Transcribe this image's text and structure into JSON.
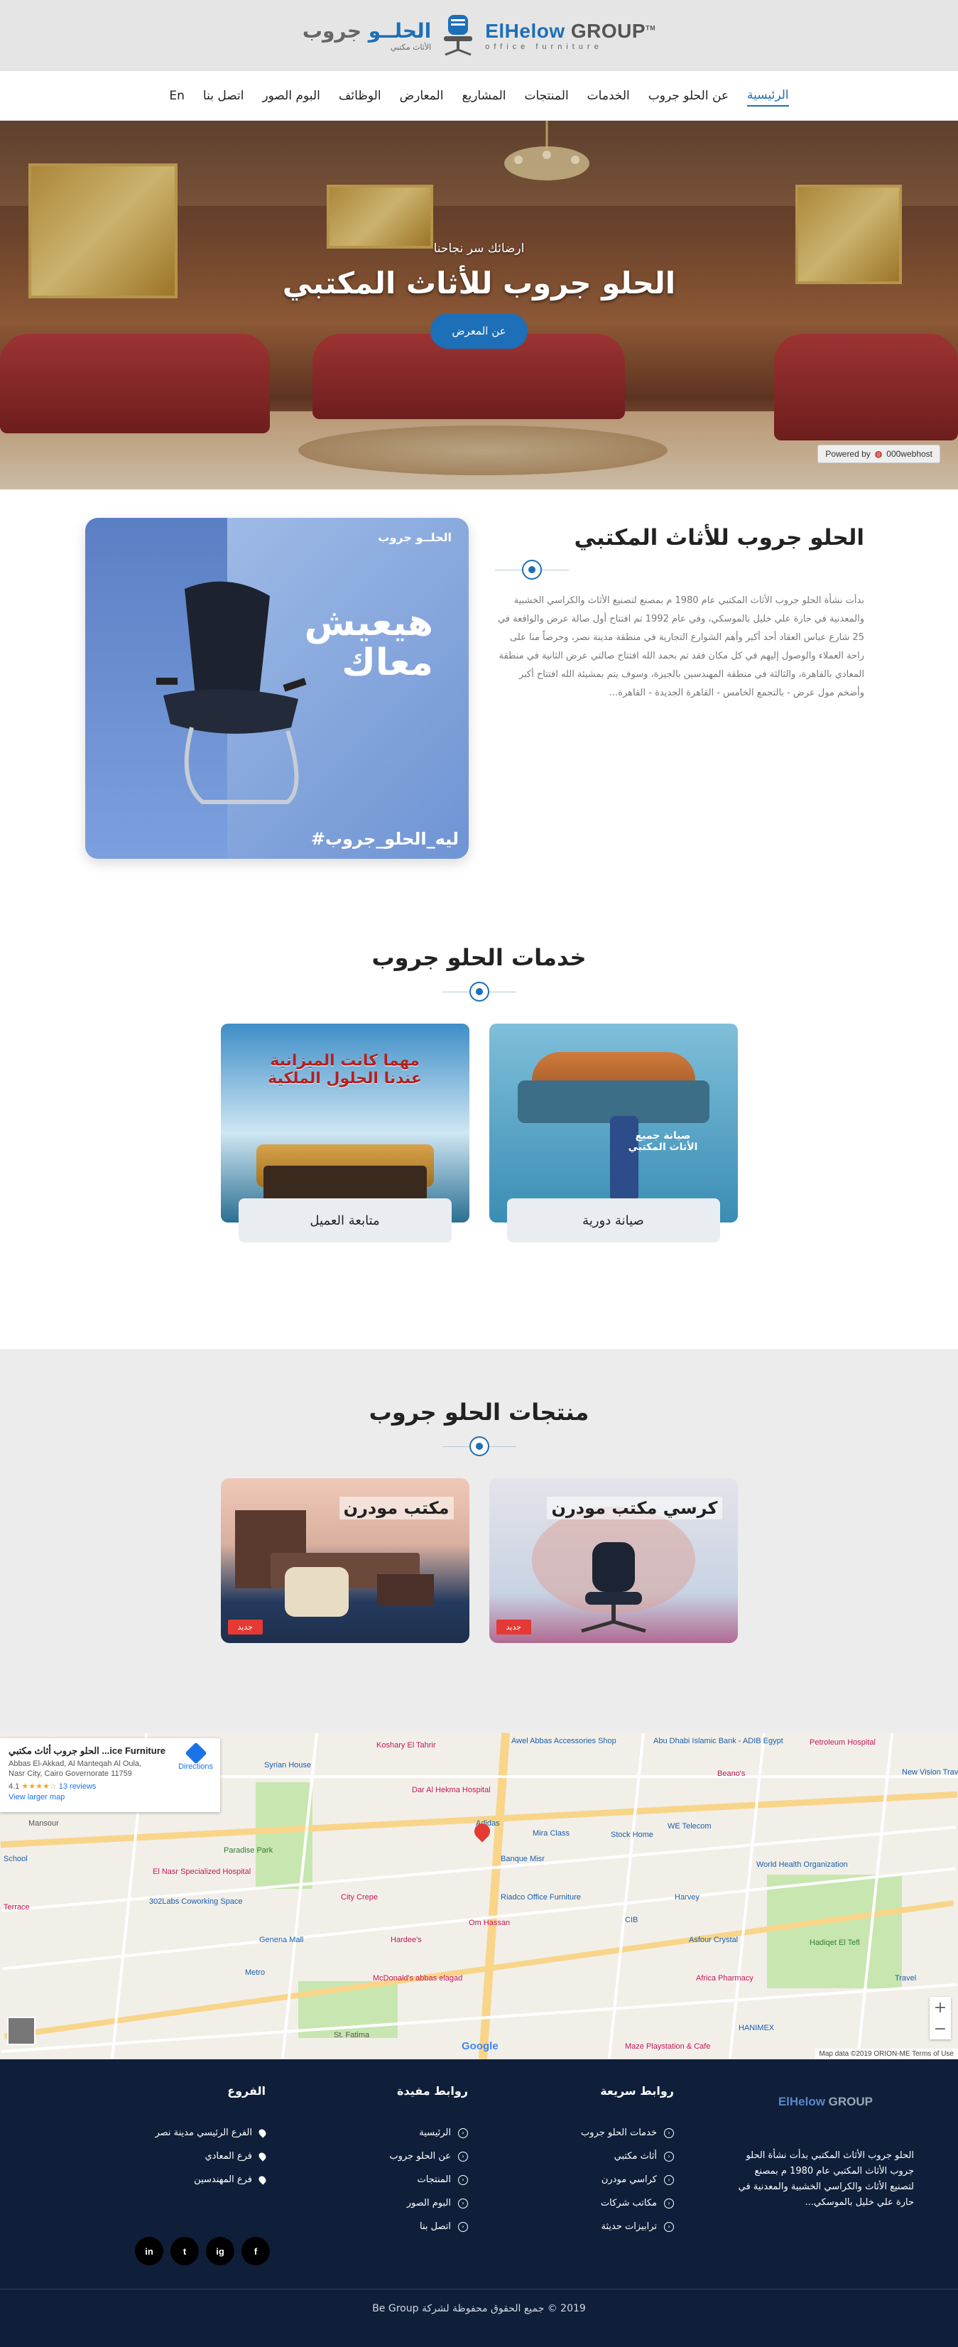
{
  "header": {
    "logo_en_main": "ElHelow",
    "logo_en_group": " GROUP",
    "logo_en_tag": "office furniture",
    "logo_ar_brand": "الحلــو",
    "logo_ar_group": " جروب",
    "logo_ar_tag": "الأثاث مكتبي",
    "tm": "TM"
  },
  "nav": {
    "items": [
      "الرئيسية",
      "عن الحلو جروب",
      "الخدمات",
      "المنتجات",
      "المشاريع",
      "المعارض",
      "الوظائف",
      "البوم الصور",
      "اتصل بنا",
      "En"
    ]
  },
  "hero": {
    "subtitle": "ارضائك سر نجاحنا",
    "title": "الحلو جروب للأثاث المكتبي",
    "button": "عن المعرض",
    "powered_label": "Powered by",
    "powered_brand": "000webhost"
  },
  "about": {
    "title": "الحلو جروب للأثاث المكتبي",
    "body": "بدأت نشأة الحلو جروب الأثاث المكتبي عام 1980 م بمصنع لتصنيع الأثاث والكراسي الخشبية والمعدنية في حارة علي خليل بالموسكي، وفي عام 1992 تم افتتاح أول صالة عرض والواقعة في 25 شارع عباس العقاد أحد أكبر وأهم الشوارع التجارية في منطقة مدينة نصر، وحرصاً منا على راحة العملاء والوصول إليهم في كل مكان فقد تم بحمد الله افتتاح صالتي عرض الثانية في منطقة المعادي بالقاهرة، والثالثة في منطقة المهندسين بالجيزة، وسوف يتم بمشيئة الله افتتاح أكبر وأضخم مول عرض - بالتجمع الخامس - القاهرة الجديدة - القاهرة...",
    "image_slogan_line1": "هيعيش",
    "image_slogan_line2": "معاك",
    "image_hashtag": "#ليه_الحلو_جروب",
    "image_logo": "الحلــو جروب"
  },
  "services": {
    "title": "خدمات الحلو جروب",
    "cards": [
      {
        "caption": "صيانة دورية",
        "image_text": "صيانة جميع الأثاث المكتبي"
      },
      {
        "caption": "متابعة العميل",
        "image_text": "مهما كانت الميزانية عندنا الحلول الملكية"
      }
    ]
  },
  "products": {
    "title": "منتجات الحلو جروب",
    "cards": [
      {
        "title": "كرسي مكتب مودرن",
        "badge": "جديد"
      },
      {
        "title": "مكتب مودرن",
        "badge": "جديد"
      }
    ]
  },
  "map": {
    "card_title": "الحلو جروب أثاث مكتبي ...ice Furniture",
    "card_address": "Abbas El-Akkad, Al Manteqah Al Oula, Nasr City, Cairo Governorate 11759",
    "rating": "4.1",
    "stars": "★★★★☆",
    "reviews": "13 reviews",
    "larger_map": "View larger map",
    "directions": "Directions",
    "labels": [
      "Koshary El Tahrir",
      "Awel Abbas Accessories Shop",
      "Abu Dhabi Islamic Bank - ADIB Egypt",
      "Syrian House",
      "Dar Al Hekma Hospital",
      "Adidas",
      "Mira Class",
      "Stock Home",
      "WE Telecom",
      "Banque Misr",
      "Riadco Office Furniture",
      "City Crepe",
      "Hardee's",
      "Om Hassan",
      "McDonald's abbas elagad",
      "El Nasr Specialized Hospital",
      "302Labs Coworking Space",
      "Genena Mall",
      "Paradise Park",
      "Petroleum Hospital",
      "World Health Organization",
      "Harvey",
      "Asfour Crystal",
      "Africa Pharmacy",
      "HANIMEX",
      "Beano's",
      "New Vision Travel",
      "Hadiqet El Tefl",
      "Travel",
      "Mansour",
      "School",
      "Terrace",
      "Metro",
      "St. Fatima",
      "Maze Playstation & Cafe",
      "CIB"
    ],
    "footer": "Map data ©2019 ORION-ME   Terms of Use",
    "zoom_in": "+",
    "zoom_out": "−",
    "google": "Google"
  },
  "footer": {
    "logo_main": "ElHelow",
    "logo_group": " GROUP",
    "about": "الحلو جروب الأثاث المكتبي بدأت نشأة الحلو جروب الأثاث المكتبي عام 1980 م بمصنع لتصنيع الأثاث والكراسي الخشبية والمعدنية في حارة علي خليل بالموسكي...",
    "quick_links_title": "روابط سريعة",
    "quick_links": [
      "خدمات الحلو جروب",
      "أثاث مكتبي",
      "كراسي مودرن",
      "مكاتب شركات",
      "ترابيزات حديثة"
    ],
    "useful_links_title": "روابط مفيدة",
    "useful_links": [
      "الرئيسية",
      "عن الحلو جروب",
      "المنتجات",
      "البوم الصور",
      "اتصل بنا"
    ],
    "branches_title": "الفروع",
    "branches": [
      "الفرع الرئيسي مدينة نصر",
      "فرع المعادي",
      "فرع المهندسين"
    ],
    "socials": [
      "f",
      "ig",
      "t",
      "in"
    ],
    "copyright": "2019 © جميع الحقوق محفوظة لشركة Be Group"
  }
}
